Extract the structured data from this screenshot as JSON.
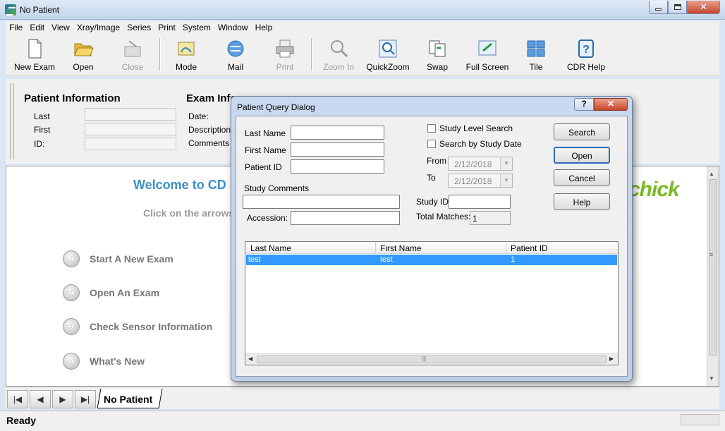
{
  "window": {
    "title": "No Patient"
  },
  "menu": [
    "File",
    "Edit",
    "View",
    "Xray/Image",
    "Series",
    "Print",
    "System",
    "Window",
    "Help"
  ],
  "toolbar": {
    "new_exam": "New Exam",
    "open": "Open",
    "close": "Close",
    "mode": "Mode",
    "mail": "Mail",
    "print": "Print",
    "zoom_in": "Zoom In",
    "quickzoom": "QuickZoom",
    "swap": "Swap",
    "full_screen": "Full Screen",
    "tile": "Tile",
    "cdr_help": "CDR Help"
  },
  "patient_info": {
    "title": "Patient Information",
    "last_label": "Last",
    "first_label": "First",
    "id_label": "ID:"
  },
  "exam_info": {
    "title": "Exam Info",
    "date_label": "Date:",
    "description_label": "Description",
    "comments_label": "Comments"
  },
  "welcome": {
    "title": "Welcome to CD",
    "hint": "Click on the arrows",
    "logo": "chick",
    "actions": [
      "Start A New Exam",
      "Open An Exam",
      "Check Sensor Information",
      "What's New"
    ]
  },
  "tabs": {
    "active": "No Patient"
  },
  "status": {
    "text": "Ready"
  },
  "dialog": {
    "title": "Patient Query Dialog",
    "help_glyph": "?",
    "close_glyph": "✕",
    "last_name_label": "Last Name",
    "first_name_label": "First Name",
    "patient_id_label": "Patient ID",
    "study_comments_label": "Study Comments",
    "accession_label": "Accession:",
    "study_level_search": "Study Level Search",
    "search_by_study_date": "Search by Study Date",
    "from_label": "From",
    "to_label": "To",
    "from_date": "2/12/2018",
    "to_date": "2/12/2018",
    "study_id_label": "Study ID",
    "total_matches_label": "Total Matches:",
    "total_matches_value": "1",
    "buttons": {
      "search": "Search",
      "open": "Open",
      "cancel": "Cancel",
      "help": "Help"
    },
    "columns": [
      "Last Name",
      "First Name",
      "Patient ID"
    ],
    "rows": [
      {
        "last": "test",
        "first": "test",
        "id": "1"
      }
    ]
  },
  "colors": {
    "accent": "#3b8fc4",
    "selection": "#3399ff",
    "logo": "#7bb929"
  }
}
